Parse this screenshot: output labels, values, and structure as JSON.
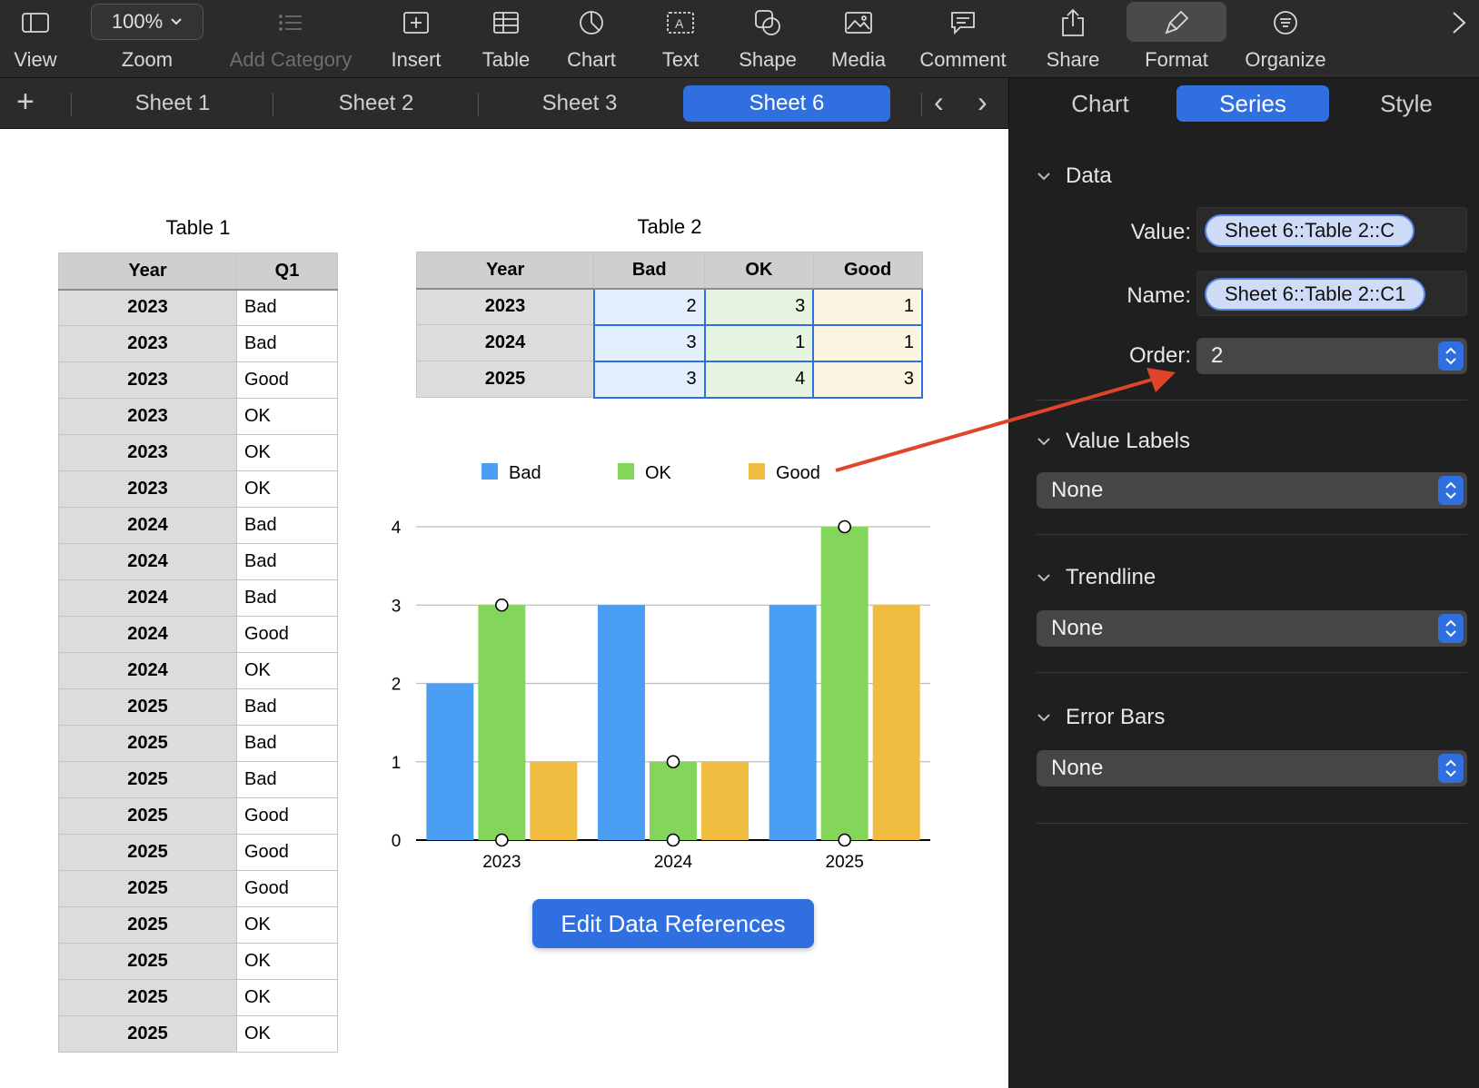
{
  "toolbar": {
    "items": [
      {
        "label": "View",
        "icon": "sidebar-icon"
      },
      {
        "label": "Zoom",
        "icon": "zoom-icon"
      },
      {
        "label": "Add Category",
        "icon": "list-icon",
        "disabled": true
      },
      {
        "label": "Insert",
        "icon": "insert-icon"
      },
      {
        "label": "Table",
        "icon": "table-icon"
      },
      {
        "label": "Chart",
        "icon": "chart-icon"
      },
      {
        "label": "Text",
        "icon": "text-icon"
      },
      {
        "label": "Shape",
        "icon": "shape-icon"
      },
      {
        "label": "Media",
        "icon": "media-icon"
      },
      {
        "label": "Comment",
        "icon": "comment-icon"
      },
      {
        "label": "Share",
        "icon": "share-icon"
      },
      {
        "label": "Format",
        "icon": "paintbrush-icon"
      },
      {
        "label": "Organize",
        "icon": "organize-icon"
      }
    ],
    "zoom_value": "100%"
  },
  "sheet_tabs": [
    "Sheet 1",
    "Sheet 2",
    "Sheet 3",
    "Sheet 6"
  ],
  "active_sheet": "Sheet 6",
  "sidebar": {
    "tabs": [
      "Chart",
      "Series",
      "Style"
    ],
    "active_tab": "Series",
    "data_section": {
      "title": "Data",
      "value_label": "Value:",
      "value_ref": "Sheet 6::Table 2::C",
      "name_label": "Name:",
      "name_ref": "Sheet 6::Table 2::C1",
      "order_label": "Order:",
      "order_value": "2"
    },
    "value_labels": {
      "title": "Value Labels",
      "value": "None"
    },
    "trendline": {
      "title": "Trendline",
      "value": "None"
    },
    "error_bars": {
      "title": "Error Bars",
      "value": "None"
    }
  },
  "table1": {
    "title": "Table 1",
    "headers": [
      "Year",
      "Q1"
    ],
    "rows": [
      [
        "2023",
        "Bad"
      ],
      [
        "2023",
        "Bad"
      ],
      [
        "2023",
        "Good"
      ],
      [
        "2023",
        "OK"
      ],
      [
        "2023",
        "OK"
      ],
      [
        "2023",
        "OK"
      ],
      [
        "2024",
        "Bad"
      ],
      [
        "2024",
        "Bad"
      ],
      [
        "2024",
        "Bad"
      ],
      [
        "2024",
        "Good"
      ],
      [
        "2024",
        "OK"
      ],
      [
        "2025",
        "Bad"
      ],
      [
        "2025",
        "Bad"
      ],
      [
        "2025",
        "Bad"
      ],
      [
        "2025",
        "Good"
      ],
      [
        "2025",
        "Good"
      ],
      [
        "2025",
        "Good"
      ],
      [
        "2025",
        "OK"
      ],
      [
        "2025",
        "OK"
      ],
      [
        "2025",
        "OK"
      ],
      [
        "2025",
        "OK"
      ]
    ]
  },
  "table2": {
    "title": "Table 2",
    "headers": [
      "Year",
      "Bad",
      "OK",
      "Good"
    ],
    "rows": [
      [
        "2023",
        "2",
        "3",
        "1"
      ],
      [
        "2024",
        "3",
        "1",
        "1"
      ],
      [
        "2025",
        "3",
        "4",
        "3"
      ]
    ]
  },
  "edit_button": "Edit Data References",
  "colors": {
    "bad": "#4a9ff5",
    "ok": "#84d65a",
    "good": "#f0bc40",
    "accent": "#2f6fe0",
    "arrow": "#e0442a"
  },
  "chart_data": {
    "type": "bar",
    "categories": [
      "2023",
      "2024",
      "2025"
    ],
    "series": [
      {
        "name": "Bad",
        "values": [
          2,
          3,
          3
        ]
      },
      {
        "name": "OK",
        "values": [
          3,
          1,
          4
        ]
      },
      {
        "name": "Good",
        "values": [
          1,
          1,
          3
        ]
      }
    ],
    "ylim": [
      0,
      4
    ],
    "yticks": [
      "0",
      "1",
      "2",
      "3",
      "4"
    ],
    "grid": true,
    "legend": "top",
    "selected_series": "OK"
  }
}
